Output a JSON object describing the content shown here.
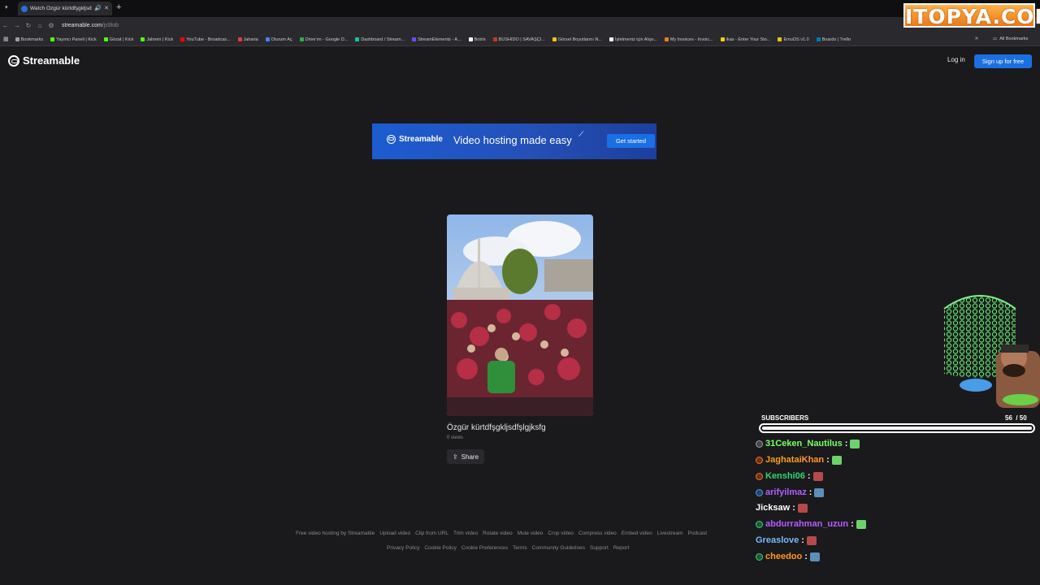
{
  "browser": {
    "tab_title": "Watch Özgür kürtdfşgkljsdf",
    "url_host": "streamable.com",
    "url_path": "/js9lob",
    "bookmarks": [
      {
        "label": "Bookmarks",
        "color": "#9aa0a6"
      },
      {
        "label": "Yayıncı Paneli | Kick",
        "color": "#53fc18"
      },
      {
        "label": "Gözat | Kick",
        "color": "#53fc18"
      },
      {
        "label": "Jahrein | Kick",
        "color": "#53fc18"
      },
      {
        "label": "YouTube - Broadcas...",
        "color": "#ff0000"
      },
      {
        "label": "Jaharia",
        "color": "#e33b3b"
      },
      {
        "label": "Oturum Aç",
        "color": "#4285f4"
      },
      {
        "label": "Drive'ım - Google D...",
        "color": "#34a853"
      },
      {
        "label": "Dashboard / Stream...",
        "color": "#13c2a0"
      },
      {
        "label": "StreamElements - A...",
        "color": "#6c4cf6"
      },
      {
        "label": "Botrix",
        "color": "#ffffff"
      },
      {
        "label": "BUSHIDO | SAVAŞÇI...",
        "color": "#c0392b"
      },
      {
        "label": "Görsel Boyutlarını N...",
        "color": "#f1c40f"
      },
      {
        "label": "İşletmeniz için Alışv...",
        "color": "#ffffff"
      },
      {
        "label": "My Invoices - Invoic...",
        "color": "#e67e22"
      },
      {
        "label": "ikas - Enter Your Sto...",
        "color": "#f5d000"
      },
      {
        "label": "EmuOS v1.0",
        "color": "#f1c40f"
      },
      {
        "label": "Boards | Trello",
        "color": "#0079bf"
      }
    ],
    "all_bookmarks": "All Bookmarks"
  },
  "overlay_logo": "ITOPYA.COM",
  "site": {
    "brand": "Streamable",
    "login": "Log in",
    "signup": "Sign up for free"
  },
  "banner": {
    "brand": "Streamable",
    "tagline": "Video hosting made easy",
    "cta": "Get started"
  },
  "video": {
    "title": "Özgür kürtdfşgkljsdfşlgjksfg",
    "views": "0 views",
    "share": "Share"
  },
  "footer": {
    "row1": [
      "Free video hosting by Streamable",
      "Upload video",
      "Clip from URL",
      "Trim video",
      "Rotate video",
      "Mute video",
      "Crop video",
      "Compress video",
      "Embed video",
      "Livestream",
      "Podcast"
    ],
    "row2": [
      "Privacy Policy",
      "Cookie Policy",
      "Cookie Preferences",
      "Terms",
      "Community Guidelines",
      "Support",
      "Report"
    ]
  },
  "subscribers": {
    "label": "SUBSCRIBERS",
    "count": "56",
    "goal": "/ 50",
    "progress": 1.0
  },
  "chat": [
    {
      "user": "31Ceken_Nautilus",
      "color": "#7dff6a",
      "badge": "#9aa0a6",
      "emote": "#6bd36b"
    },
    {
      "user": "JaghataiKhan",
      "color": "#ff9a1f",
      "badge": "#ff6a1f",
      "emote": "#6bd36b"
    },
    {
      "user": "Kenshi06",
      "color": "#2ed573",
      "badge": "#ff6a1f",
      "emote": "#b54a4a"
    },
    {
      "user": "arifyilmaz",
      "color": "#b65cff",
      "badge": "#3d9df7",
      "emote": "#5c8fb8"
    },
    {
      "user": "Jicksaw",
      "color": "#ffffff",
      "badge": "",
      "emote": "#b54a4a"
    },
    {
      "user": "abdurrahman_uzun",
      "color": "#b65cff",
      "badge": "#2ed573",
      "emote": "#6bd36b"
    },
    {
      "user": "Greaslove",
      "color": "#7ab8ff",
      "badge": "",
      "emote": "#b54a4a"
    },
    {
      "user": "cheedoo",
      "color": "#ff9a1f",
      "badge": "#2ed573",
      "emote": "#5c8fb8"
    }
  ]
}
